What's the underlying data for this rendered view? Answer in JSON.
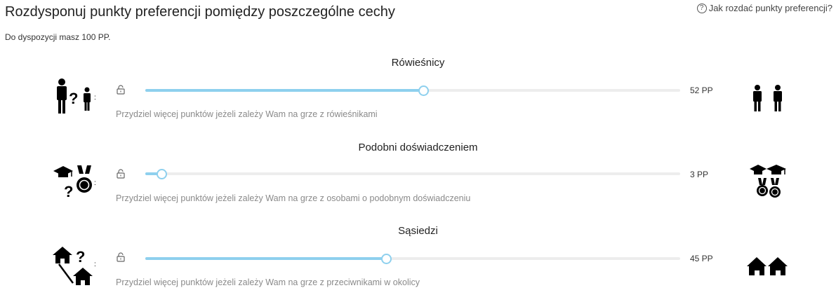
{
  "page": {
    "title": "Rozdysponuj punkty preferencji pomiędzy poszczególne cechy",
    "help_link": "Jak rozdać punkty preferencji?",
    "budget_text": "Do dyspozycji masz 100 PP."
  },
  "sections": [
    {
      "title": "Rówieśnicy",
      "value_label": "52 PP",
      "value": 52,
      "hint": "Przydziel więcej punktów jeżeli zależy Wam na grze z rówieśnikami",
      "icon_left": "person-question-person-icon",
      "icon_right": "two-persons-icon"
    },
    {
      "title": "Podobni doświadczeniem",
      "value_label": "3 PP",
      "value": 3,
      "hint": "Przydziel więcej punktów jeżeli zależy Wam na grze z osobami o podobnym doświadczeniu",
      "icon_left": "graduation-cap-medal-question-icon",
      "icon_right": "graduation-caps-medals-icon"
    },
    {
      "title": "Sąsiedzi",
      "value_label": "45 PP",
      "value": 45,
      "hint": "Przydziel więcej punktów jeżeli zależy Wam na grze z przeciwnikami w okolicy",
      "icon_left": "house-question-house-icon",
      "icon_right": "two-houses-icon"
    }
  ],
  "slider_max": 100,
  "colors": {
    "slider_fill": "#8ed0ee",
    "track": "#ededed",
    "hint": "#8a8a8a"
  }
}
